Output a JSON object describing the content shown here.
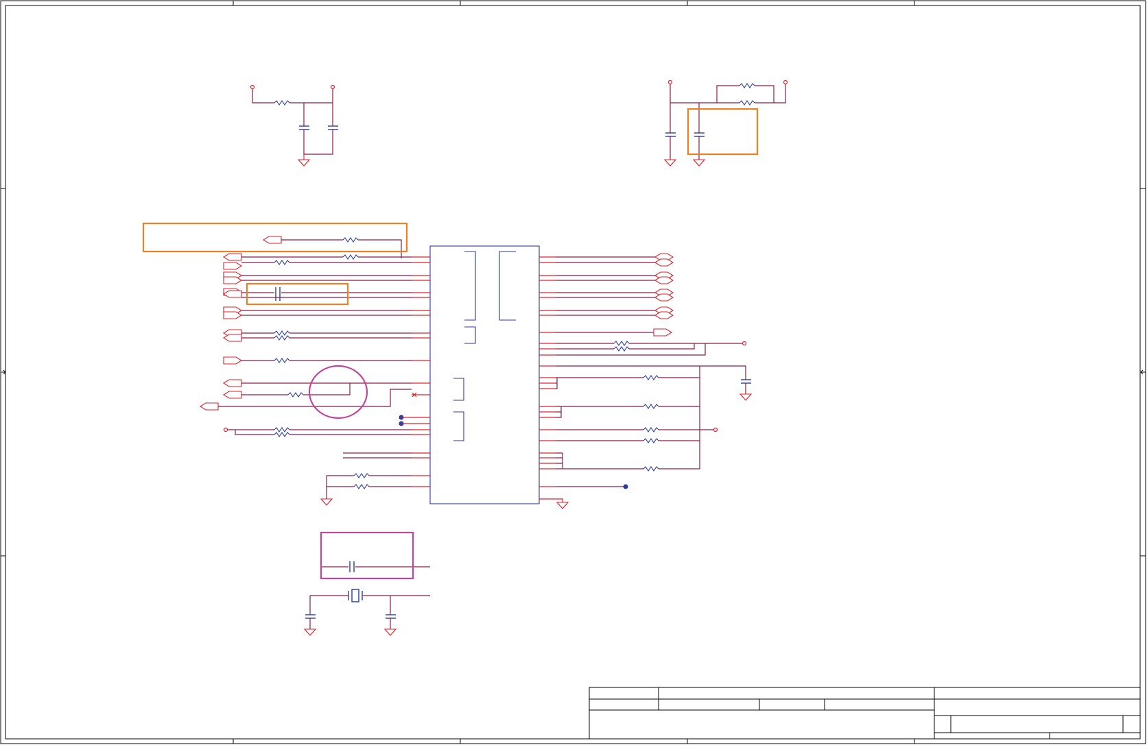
{
  "sheet": {
    "frame_color": "#000000",
    "wire_color": "#8a1a4a",
    "pin_color": "#e0202a",
    "component_color": "#2a3a9a",
    "highlight_orange": "#ee7f22",
    "highlight_magenta": "#c0469a"
  },
  "highlights": [
    {
      "name": "orange-box-decoupling",
      "color": "#ee7f22"
    },
    {
      "name": "orange-box-input-resistor",
      "color": "#ee7f22"
    },
    {
      "name": "orange-box-series-cap",
      "color": "#ee7f22"
    },
    {
      "name": "magenta-circle-unconnected-pin",
      "color": "#c0469a"
    },
    {
      "name": "magenta-box-crystal-cap",
      "color": "#c0469a"
    }
  ],
  "icons": {
    "resistor": "resistor-icon",
    "capacitor": "capacitor-icon",
    "ground": "ground-icon",
    "crystal": "crystal-icon",
    "port": "net-port-icon",
    "junction": "junction-dot-icon"
  }
}
